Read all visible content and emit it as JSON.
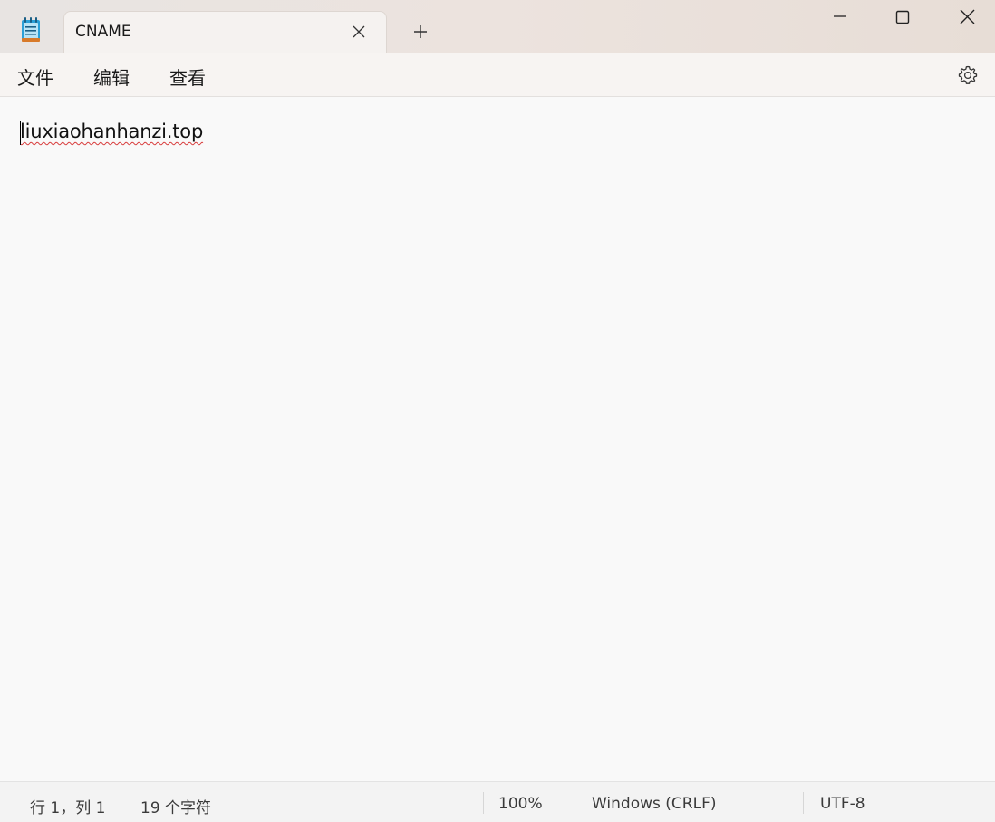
{
  "window": {
    "tab_title": "CNAME",
    "icons": {
      "app": "notepad-icon",
      "tab_close": "close-icon",
      "new_tab": "plus-icon",
      "minimize": "minimize-icon",
      "maximize": "maximize-icon",
      "close": "close-icon"
    }
  },
  "menu": {
    "file": "文件",
    "edit": "编辑",
    "view": "查看",
    "settings_icon": "gear-icon"
  },
  "editor": {
    "content": "liuxiaohanhanzi.top"
  },
  "status": {
    "position": "行 1，列 1",
    "char_count": "19 个字符",
    "zoom": "100%",
    "line_ending": "Windows (CRLF)",
    "encoding": "UTF-8"
  },
  "colors": {
    "spellcheck_underline": "#d83b3b",
    "icon_accent": "#2aa0d8"
  }
}
